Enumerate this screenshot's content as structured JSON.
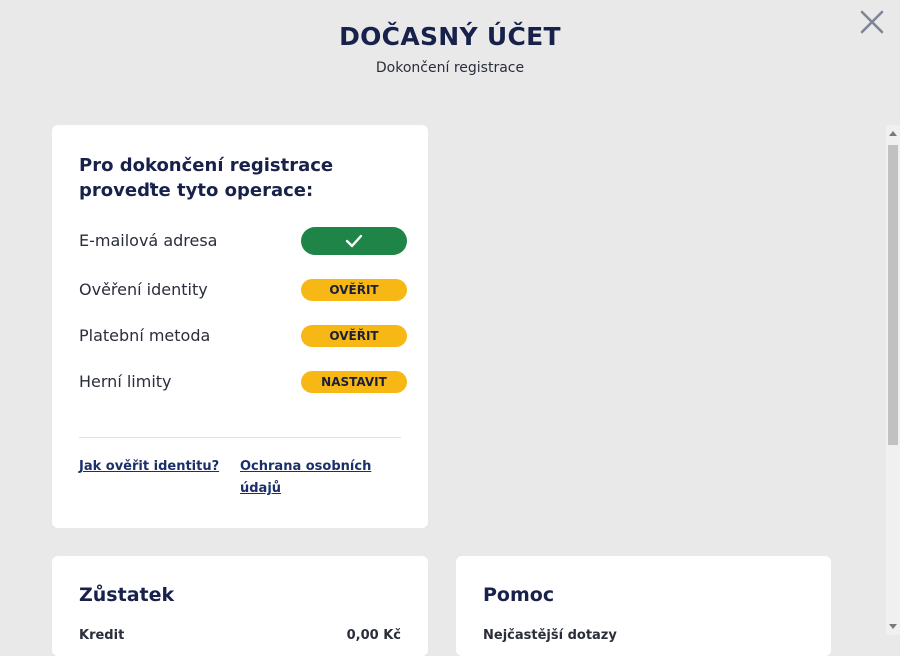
{
  "header": {
    "title": "DOČASNÝ ÚČET",
    "subtitle": "Dokončení registrace"
  },
  "main_card": {
    "heading_line1": "Pro dokončení registrace",
    "heading_line2": "proveďte tyto operace:",
    "steps": [
      {
        "label": "E-mailová adresa",
        "status": "done",
        "action": ""
      },
      {
        "label": "Ověření identity",
        "status": "pending",
        "action": "OVĚŘIT"
      },
      {
        "label": "Platební metoda",
        "status": "pending",
        "action": "OVĚŘIT"
      },
      {
        "label": "Herní limity",
        "status": "pending",
        "action": "NASTAVIT"
      }
    ],
    "links": {
      "verify_identity": "Jak ověřit identitu?",
      "privacy_line1": "Ochrana osobních",
      "privacy_line2": "údajů"
    }
  },
  "balance_card": {
    "title": "Zůstatek",
    "partial_label": "Kredit",
    "partial_value": "0,00 Kč"
  },
  "help_card": {
    "title": "Pomoc",
    "partial_text": "Nejčastější dotazy"
  },
  "colors": {
    "done": "#1e8447",
    "pending": "#f7b815",
    "title": "#17214a"
  },
  "icons": {
    "close": "close-icon",
    "check": "check-icon"
  }
}
